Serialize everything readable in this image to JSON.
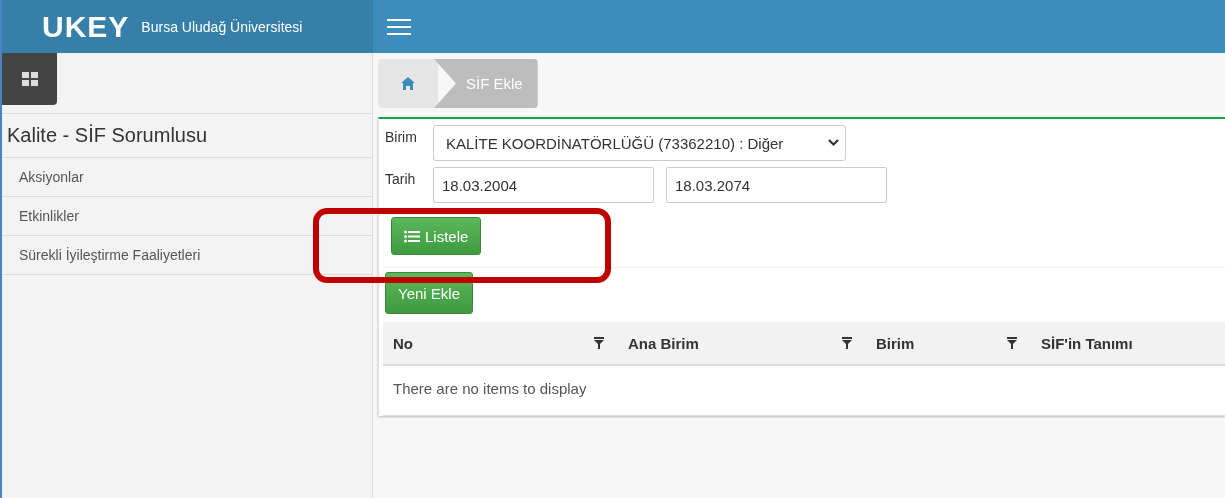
{
  "header": {
    "logo": "UKEY",
    "university": "Bursa Uludağ Üniversitesi"
  },
  "sidebar": {
    "title": "Kalite - SİF Sorumlusu",
    "items": [
      {
        "label": "Aksiyonlar",
        "selected": false
      },
      {
        "label": "Etkinlikler",
        "selected": false
      },
      {
        "label": "Sürekli İyileştirme Faaliyetleri",
        "selected": false
      }
    ]
  },
  "breadcrumb": [
    {
      "kind": "home"
    },
    {
      "kind": "page",
      "label": "SİF Ekle"
    }
  ],
  "filters": {
    "birim_label": "Birim",
    "birim_value": "KALİTE KOORDİNATÖRLÜĞÜ (73362210) : Diğer",
    "tarih_label": "Tarih",
    "date_from": "18.03.2004",
    "date_to": "18.03.2074"
  },
  "list_button": "Listele",
  "new_button": "Yeni Ekle",
  "table": {
    "columns": [
      {
        "label": "No",
        "filter": true
      },
      {
        "label": "Ana Birim",
        "filter": true
      },
      {
        "label": "Birim",
        "filter": true
      },
      {
        "label": "SİF'in Tanımı",
        "filter": false
      }
    ],
    "empty_message": "There are no items to display"
  }
}
